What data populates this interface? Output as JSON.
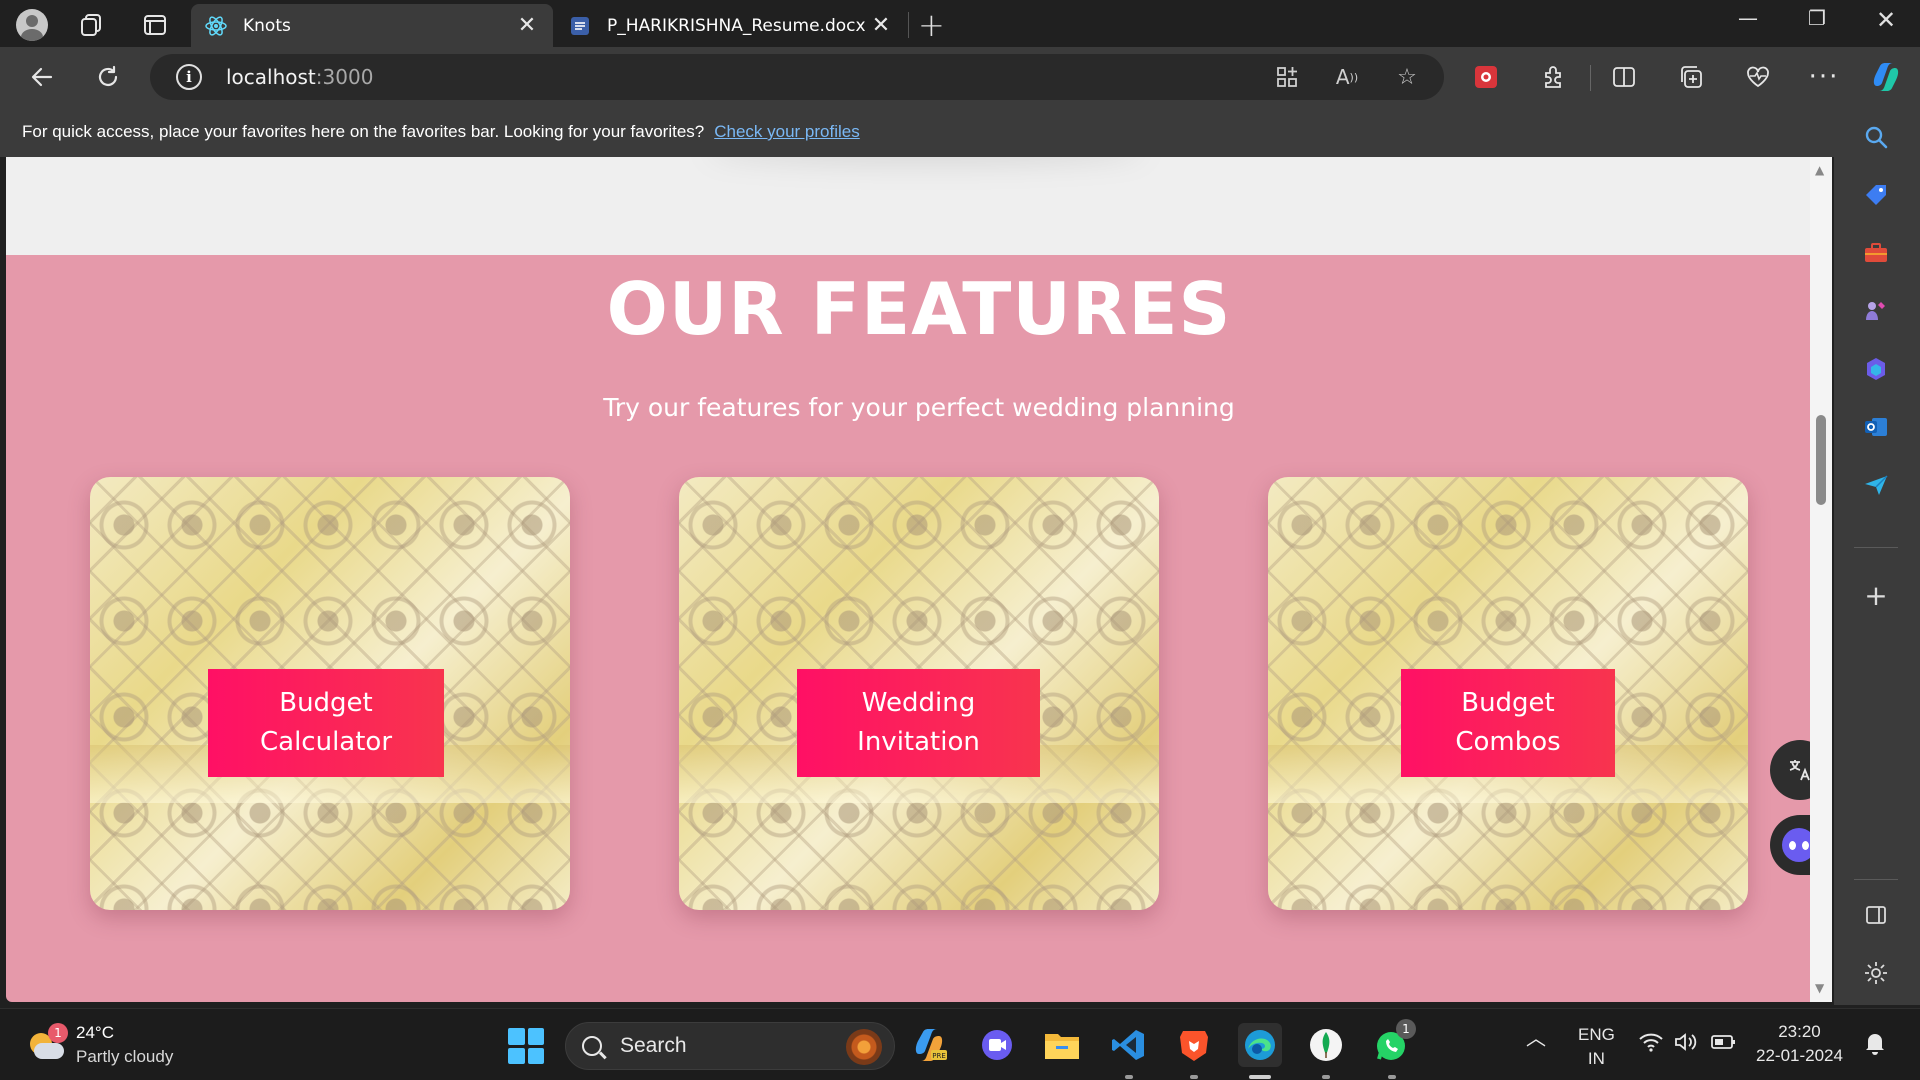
{
  "browser": {
    "tabs": [
      {
        "title": "Knots",
        "favicon": "react-icon",
        "active": true
      },
      {
        "title": "P_HARIKRISHNA_Resume.docx -",
        "favicon": "word-doc-icon",
        "active": false
      }
    ],
    "address": {
      "host": "localhost",
      "port": ":3000"
    },
    "favorites_bar": {
      "message": "For quick access, place your favorites here on the favorites bar. Looking for your favorites?",
      "link": "Check your profiles"
    }
  },
  "page": {
    "heading": "OUR FEATURES",
    "subheading": "Try our features for your perfect wedding planning",
    "features": [
      {
        "line1": "Budget",
        "line2": "Calculator"
      },
      {
        "line1": "Wedding",
        "line2": "Invitation"
      },
      {
        "line1": "Budget",
        "line2": "Combos"
      }
    ],
    "accent_gradient": [
      "#ff1065",
      "#f8344e"
    ],
    "background": "#e599aa"
  },
  "taskbar": {
    "weather": {
      "temp": "24°C",
      "condition": "Partly cloudy",
      "badge": "1"
    },
    "search_label": "Search",
    "whatsapp_badge": "1",
    "language": {
      "line1": "ENG",
      "line2": "IN"
    },
    "clock": {
      "time": "23:20",
      "date": "22-01-2024"
    }
  }
}
